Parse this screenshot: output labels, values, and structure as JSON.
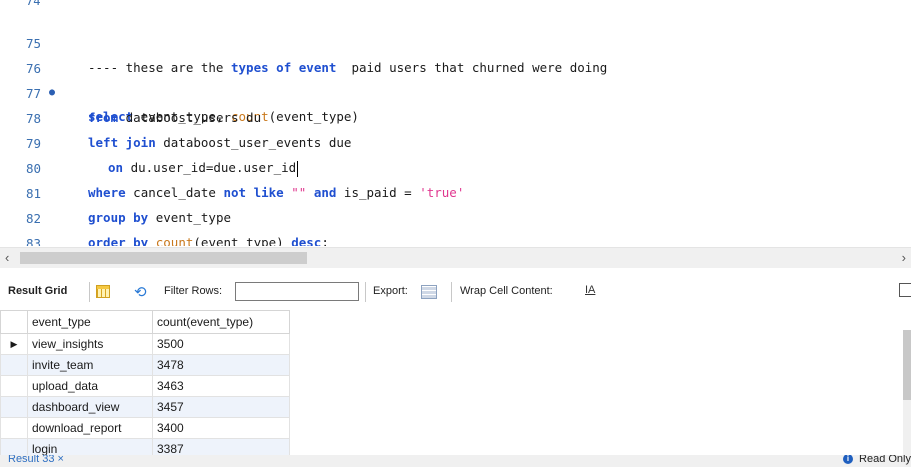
{
  "editor": {
    "top_partial_line": "74",
    "lines": [
      {
        "num": "75",
        "breakpoint": false
      },
      {
        "num": "76",
        "breakpoint": true
      },
      {
        "num": "77",
        "breakpoint": false
      },
      {
        "num": "78",
        "breakpoint": false
      },
      {
        "num": "79",
        "breakpoint": false
      },
      {
        "num": "80",
        "breakpoint": false
      },
      {
        "num": "81",
        "breakpoint": false
      },
      {
        "num": "82",
        "breakpoint": false
      },
      {
        "num": "83",
        "breakpoint": false
      }
    ],
    "tokens": {
      "l75_a": "---- these are the ",
      "l75_b": "types",
      "l75_c": " ",
      "l75_d": "of",
      "l75_e": " ",
      "l75_f": "event",
      "l75_g": "  paid users that churned were doing",
      "l76_a": "select",
      "l76_b": " event_type, ",
      "l76_c": "count",
      "l76_d": "(event_type)",
      "l77_a": "from",
      "l77_b": " databoost_users du",
      "l78_a": "left join",
      "l78_b": " databoost_user_events due",
      "l79_a": "on",
      "l79_b": " du.user_id=due.user_id",
      "l80_a": "where",
      "l80_b": " cancel_date ",
      "l80_c": "not like",
      "l80_d": " ",
      "l80_e": "\"\"",
      "l80_f": " ",
      "l80_g": "and",
      "l80_h": " is_paid = ",
      "l80_i": "'true'",
      "l81_a": "group by",
      "l81_b": " event_type",
      "l82_a": "order by",
      "l82_b": " ",
      "l82_c": "count",
      "l82_d": "(event_type) ",
      "l82_e": "desc",
      "l82_f": ";"
    }
  },
  "toolbar": {
    "result_grid_label": "Result Grid",
    "filter_rows_label": "Filter Rows:",
    "filter_value": "",
    "export_label": "Export:",
    "wrap_label": "Wrap Cell Content:",
    "wrap_icon_glyph": "IA"
  },
  "grid": {
    "columns": [
      "event_type",
      "count(event_type)"
    ],
    "rows": [
      {
        "event_type": "view_insights",
        "count": "3500",
        "selected": true
      },
      {
        "event_type": "invite_team",
        "count": "3478"
      },
      {
        "event_type": "upload_data",
        "count": "3463"
      },
      {
        "event_type": "dashboard_view",
        "count": "3457"
      },
      {
        "event_type": "download_report",
        "count": "3400"
      },
      {
        "event_type": "login",
        "count": "3387"
      }
    ],
    "row_marker": "▶"
  },
  "tabbar": {
    "tab_label": "Result 33",
    "tab_close": "×",
    "status_text": "Read Only"
  },
  "colors": {
    "keyword": "#1f4fd0",
    "function": "#c9781c",
    "string": "#e0378f",
    "line_number": "#3a6fb0",
    "alt_row": "#eef3fb"
  }
}
